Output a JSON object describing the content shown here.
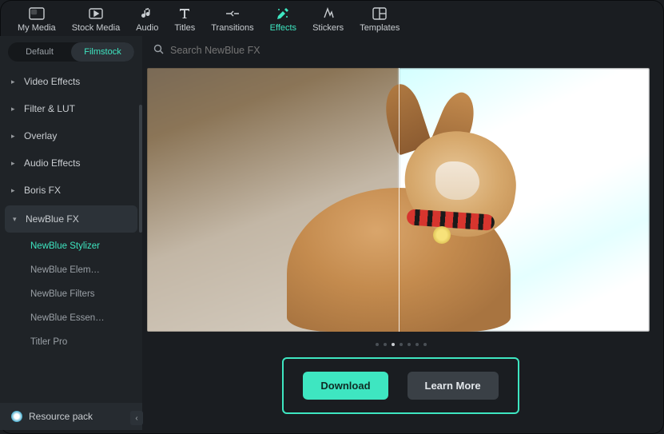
{
  "topbar": {
    "items": [
      {
        "label": "My Media",
        "icon": "media-library-icon"
      },
      {
        "label": "Stock Media",
        "icon": "stock-media-icon"
      },
      {
        "label": "Audio",
        "icon": "music-note-icon"
      },
      {
        "label": "Titles",
        "icon": "titles-icon"
      },
      {
        "label": "Transitions",
        "icon": "transitions-icon"
      },
      {
        "label": "Effects",
        "icon": "effects-icon"
      },
      {
        "label": "Stickers",
        "icon": "stickers-icon"
      },
      {
        "label": "Templates",
        "icon": "templates-icon"
      }
    ],
    "active_index": 5
  },
  "sidebar": {
    "tabs": {
      "default": "Default",
      "filmstock": "Filmstock",
      "active": "filmstock"
    },
    "categories": [
      {
        "label": "Video Effects"
      },
      {
        "label": "Filter & LUT"
      },
      {
        "label": "Overlay"
      },
      {
        "label": "Audio Effects"
      },
      {
        "label": "Boris FX"
      },
      {
        "label": "NewBlue FX",
        "expanded": true,
        "children": [
          {
            "label": "NewBlue Stylizer",
            "active": true
          },
          {
            "label": "NewBlue Elem…"
          },
          {
            "label": "NewBlue Filters"
          },
          {
            "label": "NewBlue Essen…"
          },
          {
            "label": "Titler Pro"
          }
        ]
      }
    ],
    "resource_pack": "Resource pack"
  },
  "search": {
    "placeholder": "Search NewBlue FX"
  },
  "cta": {
    "download": "Download",
    "learn_more": "Learn More"
  },
  "pagination": {
    "count": 7,
    "active": 2
  }
}
